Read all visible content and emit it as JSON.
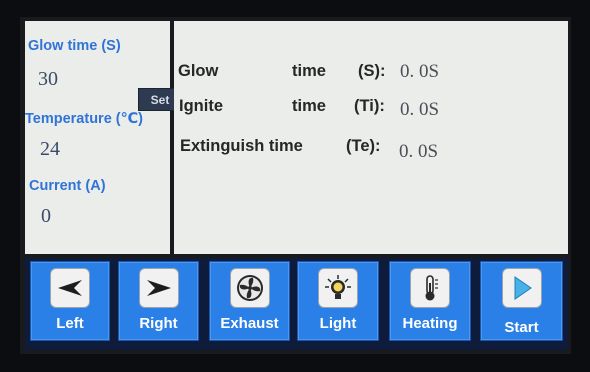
{
  "left_panel": {
    "glow_time": {
      "label": "Glow time  (S)",
      "value": "30",
      "set_label": "Set"
    },
    "temperature": {
      "label": "Temperature  (℃)",
      "value": "24"
    },
    "current": {
      "label": "Current  (A)",
      "value": "0"
    }
  },
  "results": [
    {
      "name": "Glow",
      "word": "time",
      "unit": "(S):",
      "value": "0. 0S"
    },
    {
      "name": "Ignite",
      "word": "time",
      "unit": "(Ti):",
      "value": "0. 0S"
    },
    {
      "name": "Extinguish time",
      "word": "",
      "unit": "(Te):",
      "value": "0. 0S"
    }
  ],
  "buttons": [
    {
      "label": "Left",
      "icon": "left-arrow-icon"
    },
    {
      "label": "Right",
      "icon": "right-arrow-icon"
    },
    {
      "label": "Exhaust",
      "icon": "fan-icon"
    },
    {
      "label": "Light",
      "icon": "light-bulb-icon"
    },
    {
      "label": "Heating",
      "icon": "thermometer-icon"
    },
    {
      "label": "Start",
      "icon": "play-icon"
    }
  ],
  "colors": {
    "accent_blue": "#2a80e6",
    "label_blue": "#2f74d6",
    "panel_bg": "#ebedeb"
  }
}
